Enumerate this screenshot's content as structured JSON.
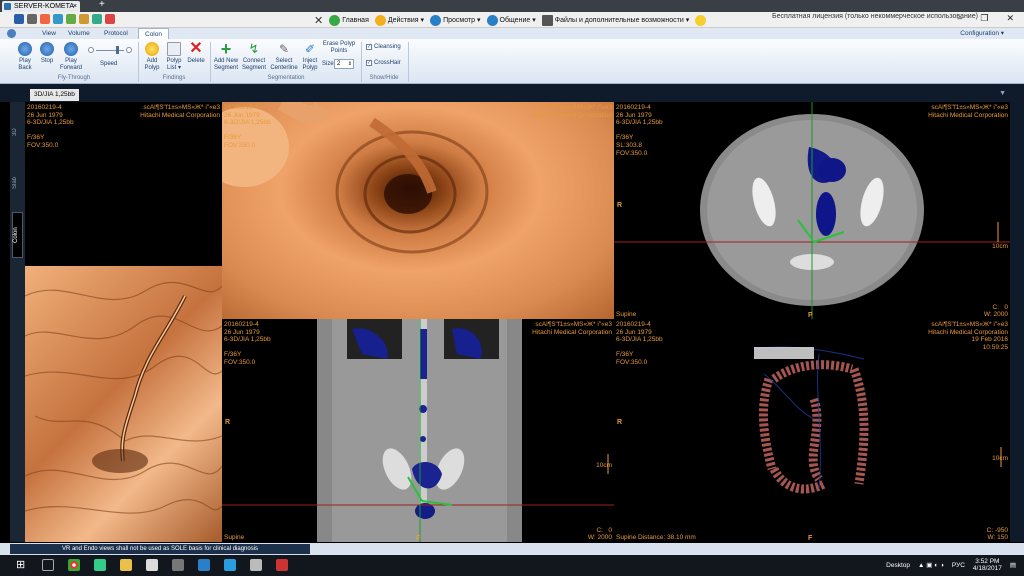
{
  "titlebar": {
    "tab_title": "SERVER-KOMETA",
    "new_tab": "+",
    "close": "×"
  },
  "quickbar": {
    "menu": [
      {
        "label": "Главная",
        "icon": "refresh-icon",
        "color": "#3aa845"
      },
      {
        "label": "Действия",
        "icon": "lightning-icon",
        "color": "#f2b01e"
      },
      {
        "label": "Просмотр",
        "icon": "eye-icon",
        "color": "#2a7fc9"
      },
      {
        "label": "Общение",
        "icon": "chat-icon",
        "color": "#2a7fc9"
      },
      {
        "label": "Файлы и дополнительные возможности",
        "icon": "folder-icon",
        "color": "#555555"
      }
    ],
    "license": "Бесплатная лицензия (только некоммерческое использование)"
  },
  "ribbon_tabs": {
    "tabs": [
      "View",
      "Volume",
      "Protocol",
      "Colon"
    ],
    "active": "Colon",
    "config": "Configuration ▾"
  },
  "ribbon": {
    "fly_through": {
      "play_back": "Play Back",
      "stop": "Stop",
      "play_forward": "Play Forward",
      "speed": "Speed",
      "group": "Fly-Through"
    },
    "findings": {
      "add_polyp": "Add Polyp",
      "polyp_list": "Polyp List ▾",
      "delete": "Delete",
      "group": "Findings"
    },
    "segmentation": {
      "add_new_segment": "Add New Segment",
      "connect_segment": "Connect Segment",
      "select_centerline": "Select Centerline",
      "inject_polyp": "Inject Polyp",
      "erase_polyp_points": "Erase Polyp Points",
      "size_label": "Size",
      "size_value": "2",
      "group": "Segmentation"
    },
    "show_hide": {
      "cleansing": "Cleansing",
      "crosshair": "CrossHair",
      "group": "Show/Hide"
    }
  },
  "strip": {
    "series_label": "3D/JIA 1,25bb"
  },
  "vtabs": [
    "3D",
    "Slab",
    "Colon"
  ],
  "viewports": {
    "top_left": {
      "left": "20160219-4\n26 Jun 1979\n6-3D/JIA 1,25bb\n\nF/36Y\nFOV:350.0",
      "right": "scAl¶S\"f1±s»MS«Ж* i\"«e3\nHitachi Medical Corporation"
    },
    "endo": {
      "left": "20160219-4\n26 Jun 1979\n6-3D/JIA 1,25bb\n\nF/36Y\nFOV:350.0",
      "right": "scAl¶S\"f1±s»MS«Ж* i\"«e3\nHitachi Medical Corporation"
    },
    "axial": {
      "left": "20160219-4\n26 Jun 1979\n6-3D/JIA 1,25bb\n\nF/36Y\nSL:303.8\nFOV:350.0",
      "right": "scAl¶S\"f1±s»MS«Ж* i\"«e3\nHitachi Medical Corporation",
      "r_label": "R",
      "p_label": "P",
      "scale": "10cm",
      "bottom_left": "Supine",
      "bottom_right": "C:   0\nW: 2000"
    },
    "coronal": {
      "left": "20160219-4\n26 Jun 1979\n6-3D/JIA 1,25bb\n\nF/36Y\nFOV:350.0",
      "right": "scAl¶S\"f1±s»MS«Ж* i\"«e3\nHitachi Medical Corporation",
      "r_label": "R",
      "f_label": "F",
      "scale": "10cm",
      "bottom_left": "Supine",
      "bottom_right": "C:   0\nW: 2000"
    },
    "volume3d": {
      "left": "20160219-4\n26 Jun 1979\n6-3D/JIA 1,25bb\n\nF/36Y\nFOV:350.0",
      "right": "scAl¶S\"f1±s»MS«Ж* i\"«e3\nHitachi Medical Corporation\n19 Feb 2016\n10:59:25",
      "r_label": "R",
      "f_label": "F",
      "scale": "10cm",
      "bottom_left": "Supine Distance: 38.10 mm",
      "bottom_right": "C: -950\nW: 150"
    }
  },
  "status": {
    "message": "VR and Endo views shall not be used as SOLE basis for clinical diagnosis"
  },
  "taskbar": {
    "desktop": "Desktop",
    "lang": "РУС",
    "time": "3:52 PM",
    "date": "4/18/2017"
  }
}
